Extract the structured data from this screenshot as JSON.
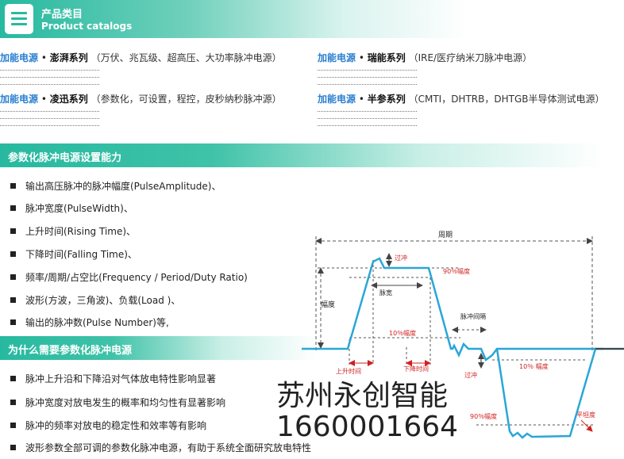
{
  "header": {
    "title": "产品类目",
    "subtitle": "Product catalogs",
    "icon": "menu-icon"
  },
  "catalogs": [
    {
      "brand": "加能电源",
      "dot": "•",
      "series": "澎湃系列",
      "desc": "（万伏、兆瓦级、超高压、大功率脉冲电源）"
    },
    {
      "brand": "加能电源",
      "dot": "•",
      "series": "瑞能系列",
      "desc": "（IRE/医疗纳米刀脉冲电源）"
    },
    {
      "brand": "加能电源",
      "dot": "•",
      "series": "凌迅系列",
      "desc": "（参数化，可设置，程控，皮秒纳秒脉冲源）"
    },
    {
      "brand": "加能电源",
      "dot": "•",
      "series": "半参系列",
      "desc": "（CMTI，DHTRB，DHTGB半导体测试电源）"
    }
  ],
  "section1": {
    "title": "参数化脉冲电源设置能力",
    "items": [
      "输出高压脉冲的脉冲幅度(PulseAmplitude)、",
      "脉冲宽度(PulseWidth)、",
      "上升时间(Rising Time)、",
      "下降时间(Falling Time)、",
      "频率/周期/占空比(Frequency / Period/Duty Ratio)",
      "波形(方波，三角波)、负载(Load )、",
      "输出的脉冲数(Pulse Number)等,"
    ]
  },
  "section2": {
    "title": "为什么需要参数化脉冲电源",
    "items": [
      "脉冲上升沿和下降沿对气体放电特性影响显著",
      "脉冲宽度对放电发生的概率和均匀性有显著影响",
      "脉冲的频率对放电的稳定性和效率等有影响",
      "波形参数全部可调的参数化脉冲电源，有助于系统全面研究放电特性"
    ]
  },
  "watermark": {
    "company": "苏州永创智能",
    "phone": "1660001664"
  },
  "diagram": {
    "labels": {
      "period": "周期",
      "overshoot": "过冲",
      "amp90": "90％幅度",
      "pulse_width": "脉宽",
      "amplitude": "幅度",
      "pulse_interval": "脉冲间隔",
      "amp10": "10％幅度",
      "rise_time": "上升时间",
      "fall_time": "下降时间",
      "amp10_neg": "10％ 幅度",
      "undershoot": "过冲",
      "amp90_neg": "90％幅度",
      "flatness": "平坦度"
    },
    "colors": {
      "waveform": "#2aa6d8",
      "annotation": "#d02020",
      "guide": "#555555"
    }
  }
}
